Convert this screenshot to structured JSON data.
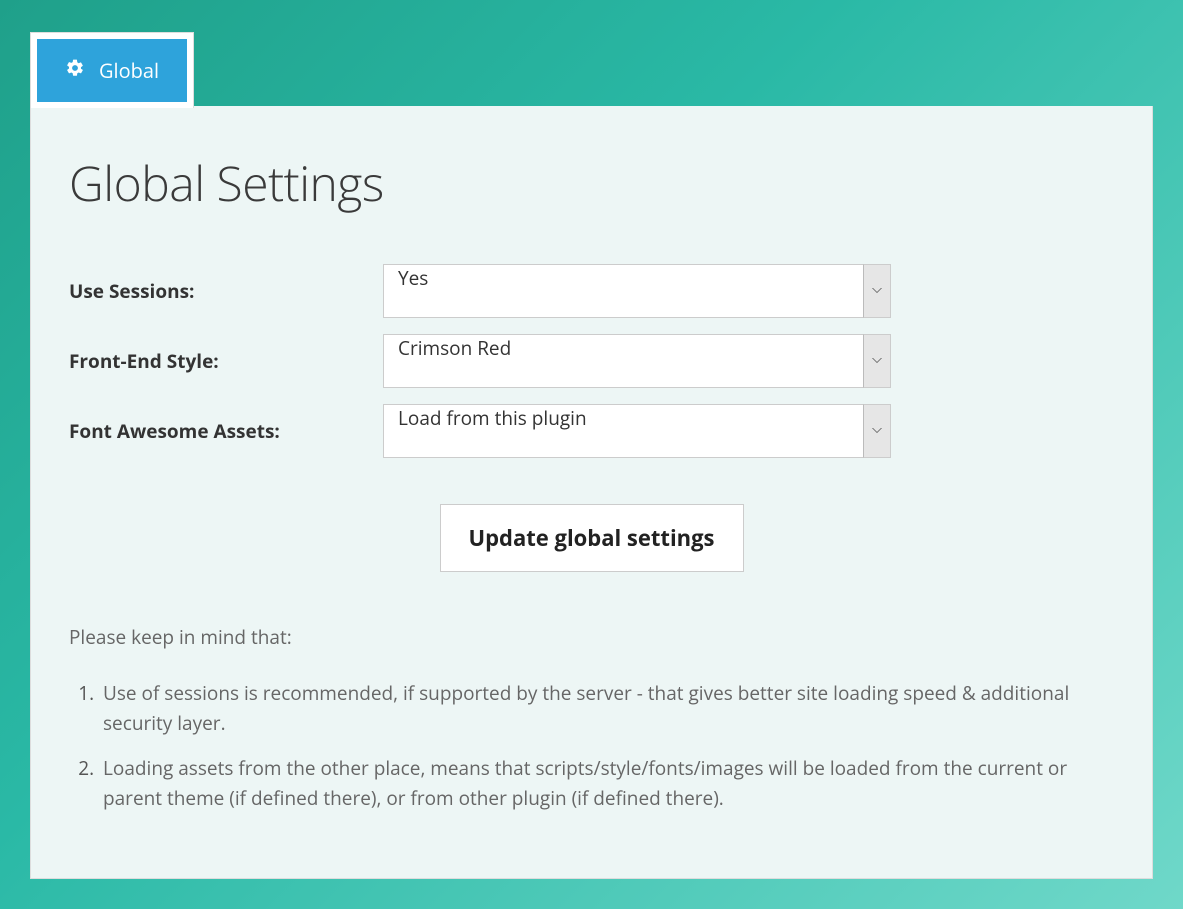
{
  "tab": {
    "label": "Global"
  },
  "page": {
    "title": "Global Settings"
  },
  "form": {
    "fields": {
      "use_sessions": {
        "label": "Use Sessions:",
        "value": "Yes"
      },
      "front_end_style": {
        "label": "Front-End Style:",
        "value": "Crimson Red"
      },
      "font_awesome_assets": {
        "label": "Font Awesome Assets:",
        "value": "Load from this plugin"
      }
    },
    "submit_label": "Update global settings"
  },
  "notes": {
    "intro": "Please keep in mind that:",
    "items": [
      "Use of sessions is recommended, if supported by the server - that gives better site loading speed & additional security layer.",
      "Loading assets from the other place, means that scripts/style/fonts/images will be loaded from the current or parent theme (if defined there), or from other plugin (if defined there)."
    ]
  }
}
